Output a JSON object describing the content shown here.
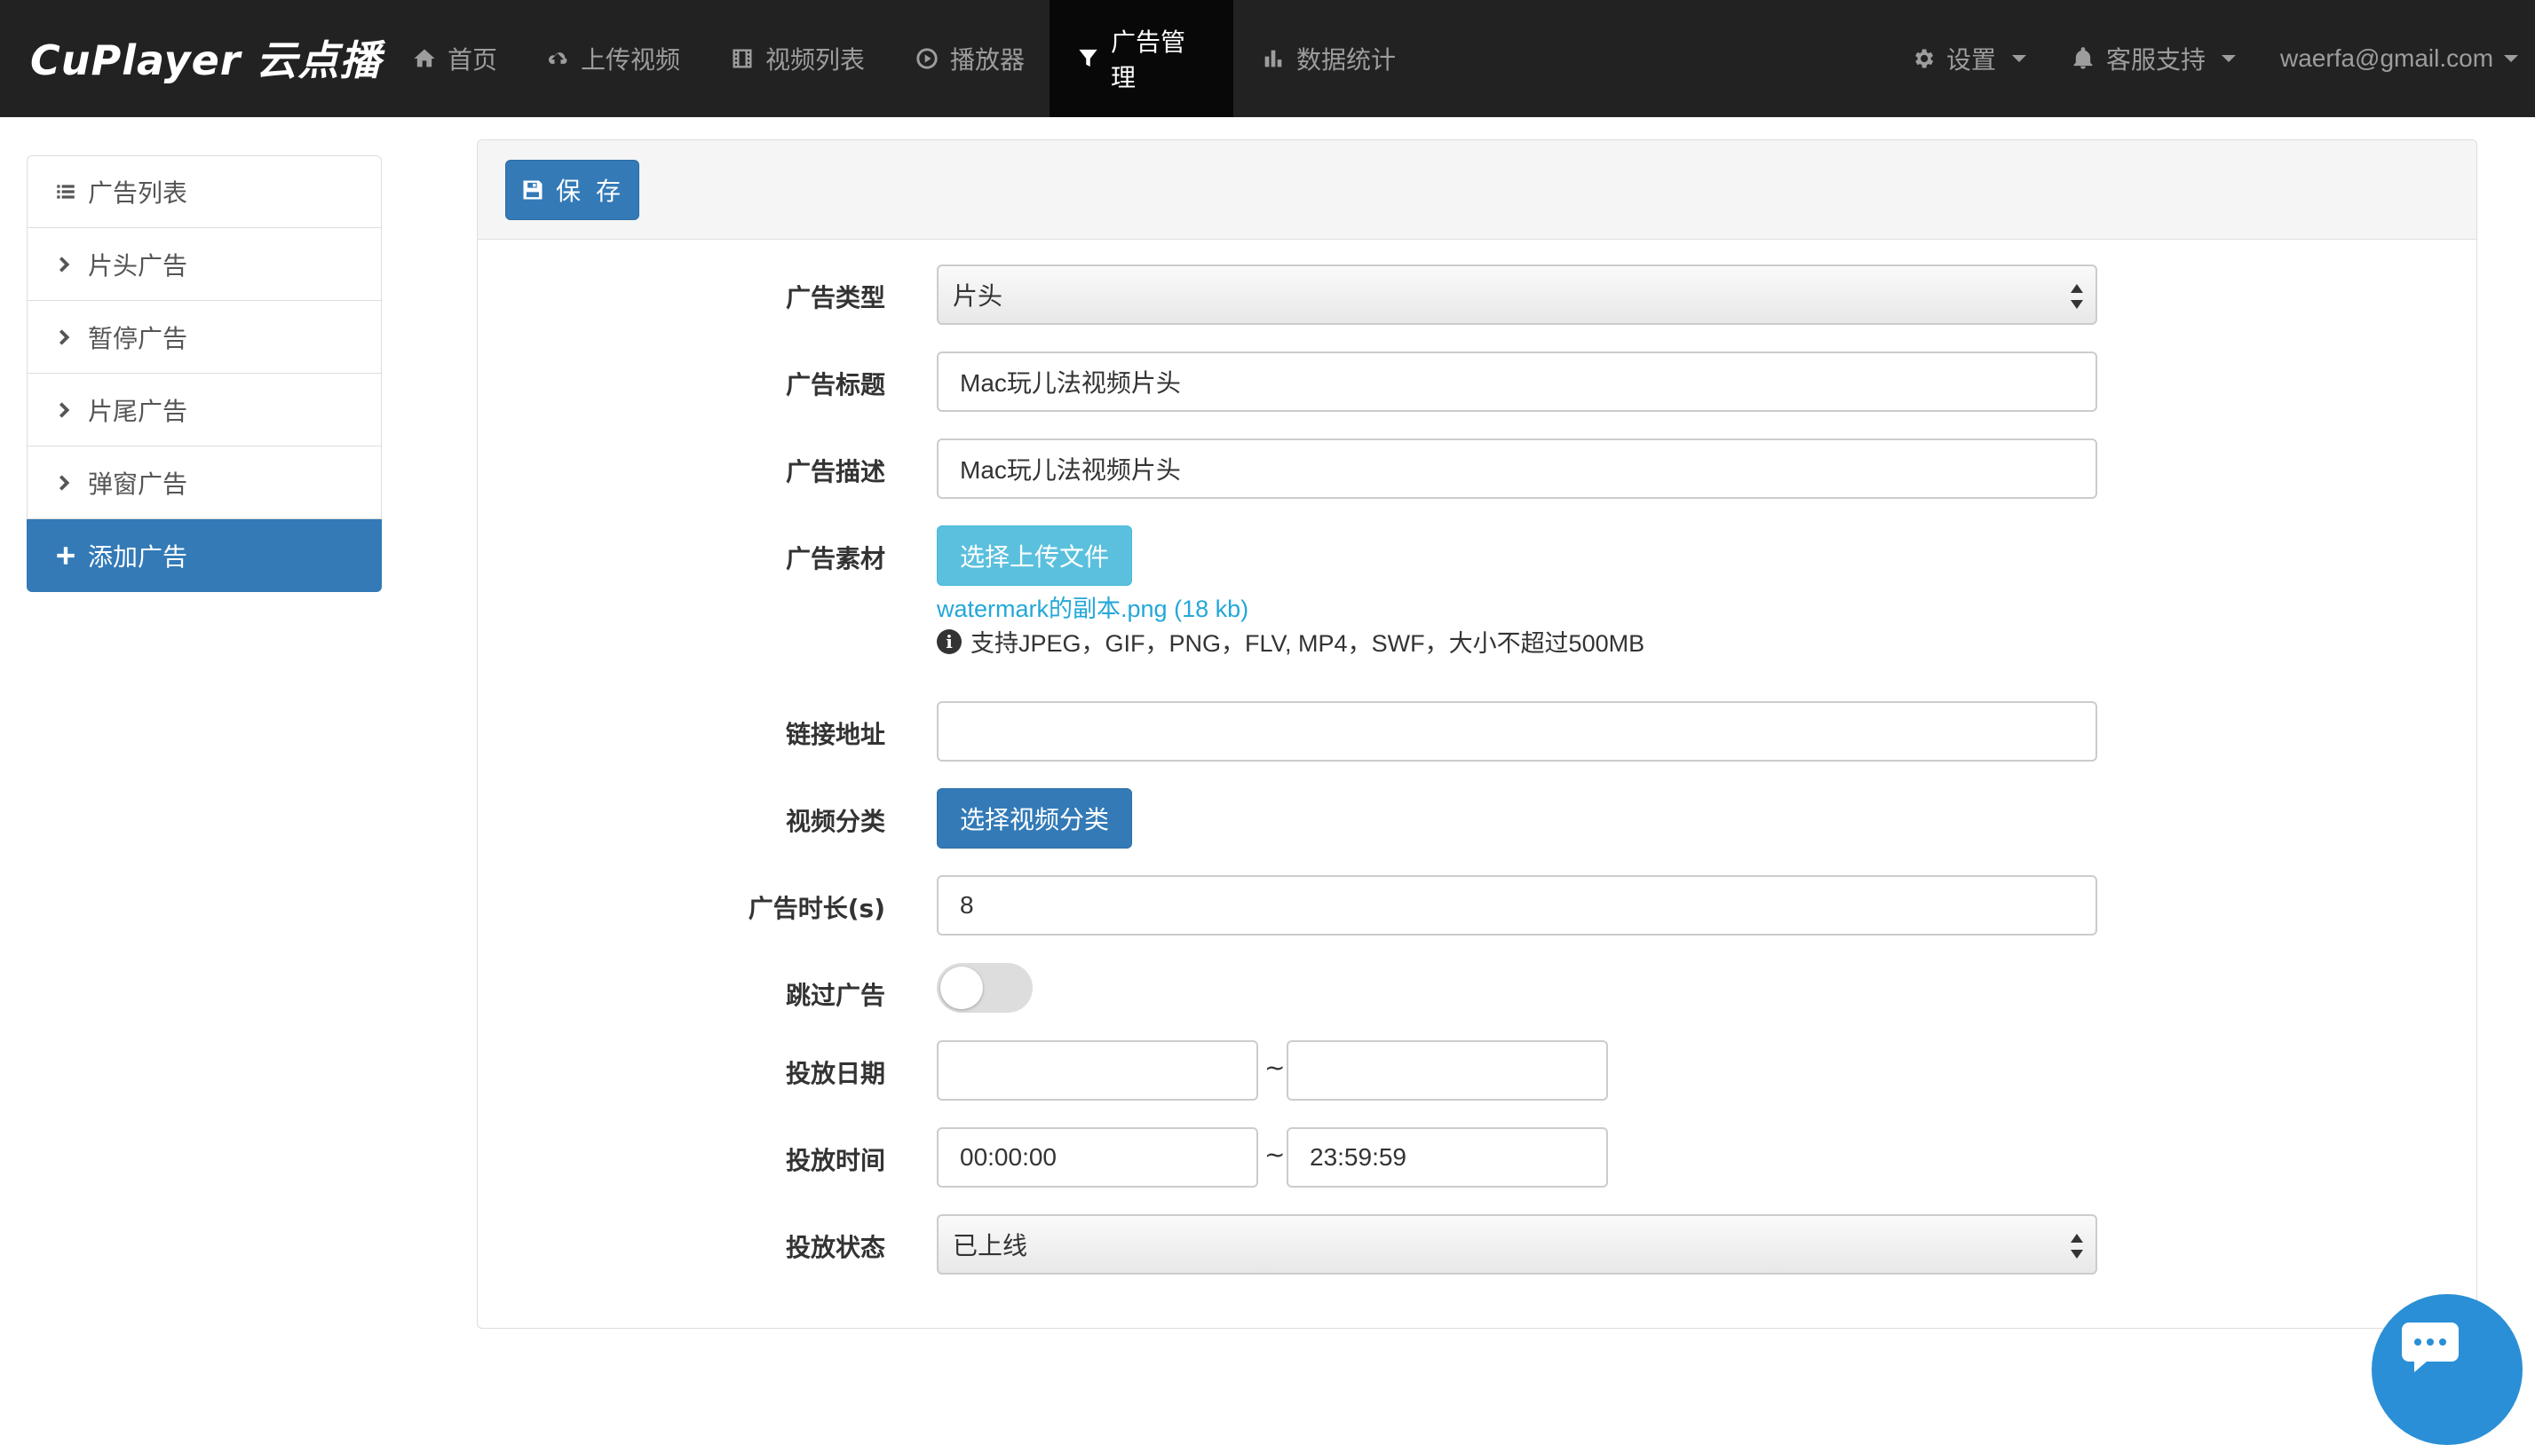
{
  "brand": {
    "logo_text": "CuPlayer 云点播"
  },
  "nav": {
    "items": [
      {
        "label": "首页",
        "icon": "home-icon"
      },
      {
        "label": "上传视频",
        "icon": "cloud-upload-icon"
      },
      {
        "label": "视频列表",
        "icon": "film-icon"
      },
      {
        "label": "播放器",
        "icon": "play-circle-icon"
      },
      {
        "label": "广告管理",
        "icon": "filter-icon",
        "active": true
      },
      {
        "label": "数据统计",
        "icon": "bar-chart-icon"
      }
    ],
    "settings_label": "设置",
    "support_label": "客服支持",
    "user_email": "waerfa@gmail.com"
  },
  "sidebar": {
    "items": [
      {
        "label": "广告列表",
        "icon": "list-icon"
      },
      {
        "label": "片头广告",
        "icon": "chevron-right-icon"
      },
      {
        "label": "暂停广告",
        "icon": "chevron-right-icon"
      },
      {
        "label": "片尾广告",
        "icon": "chevron-right-icon"
      },
      {
        "label": "弹窗广告",
        "icon": "chevron-right-icon"
      },
      {
        "label": "添加广告",
        "icon": "plus-icon",
        "active": true
      }
    ]
  },
  "toolbar": {
    "save_label": "保 存"
  },
  "form": {
    "ad_type": {
      "label": "广告类型",
      "value": "片头"
    },
    "ad_title": {
      "label": "广告标题",
      "value": "Mac玩儿法视频片头"
    },
    "ad_desc": {
      "label": "广告描述",
      "value": "Mac玩儿法视频片头"
    },
    "ad_material": {
      "label": "广告素材",
      "button_label": "选择上传文件",
      "file_name": "watermark的副本.png (18 kb)",
      "help_text": "支持JPEG，GIF，PNG，FLV, MP4，SWF，大小不超过500MB"
    },
    "link_url": {
      "label": "链接地址",
      "value": ""
    },
    "video_category": {
      "label": "视频分类",
      "button_label": "选择视频分类"
    },
    "ad_duration": {
      "label": "广告时长(s)",
      "value": "8"
    },
    "skip_ad": {
      "label": "跳过广告",
      "enabled": false
    },
    "date_range": {
      "label": "投放日期",
      "start": "",
      "end": "",
      "separator": "~"
    },
    "time_range": {
      "label": "投放时间",
      "start": "00:00:00",
      "end": "23:59:59",
      "separator": "~"
    },
    "status": {
      "label": "投放状态",
      "value": "已上线"
    }
  },
  "colors": {
    "navbar_bg": "#222222",
    "primary": "#337ab7",
    "info": "#5bc0de",
    "link": "#23a7d8",
    "chat": "#2a8fd6"
  }
}
